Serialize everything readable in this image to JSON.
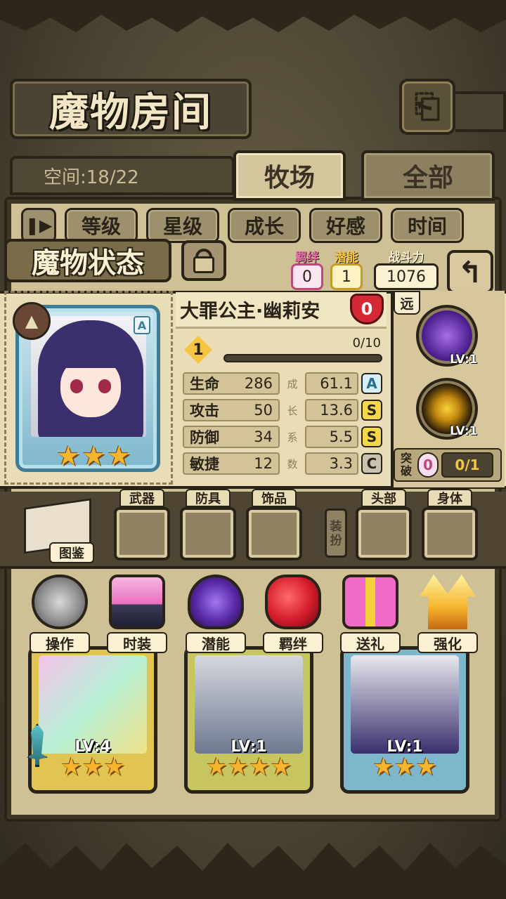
{
  "header": {
    "title": "魔物房间",
    "back_icon": "back-arrow-icon"
  },
  "space": {
    "label": "空间:18/22"
  },
  "tabs": [
    {
      "label": "牧场",
      "active": true
    },
    {
      "label": "全部",
      "active": false
    }
  ],
  "filters": {
    "pause_icon": "pause-icon",
    "items": [
      "等级",
      "星级",
      "成长",
      "好感",
      "时间"
    ]
  },
  "status": {
    "title": "魔物状态",
    "lock_icon": "lock-icon",
    "bond": {
      "label": "羁绊",
      "value": "0",
      "color": "#e86fa8"
    },
    "potential": {
      "label": "潜能",
      "value": "1",
      "color": "#f5c542"
    },
    "power": {
      "label": "战斗力",
      "value": "1076"
    },
    "return_icon": "return-arrow-icon"
  },
  "monster": {
    "name": "大罪公主·幽莉安",
    "affection": "0",
    "rank": "A",
    "type_icon": "mountain-type-icon",
    "stars": 3,
    "level": "1",
    "exp": "0/10",
    "growth_label_chars": [
      "成",
      "长",
      "系",
      "数"
    ],
    "stats": [
      {
        "name": "生命",
        "value": "286",
        "growth": "61.1",
        "grade": "A"
      },
      {
        "name": "攻击",
        "value": "50",
        "growth": "13.6",
        "grade": "S"
      },
      {
        "name": "防御",
        "value": "34",
        "growth": "5.5",
        "grade": "S"
      },
      {
        "name": "敏捷",
        "value": "12",
        "growth": "3.3",
        "grade": "C"
      }
    ],
    "range": "远",
    "skills": [
      {
        "icon": "dark-shadow-skill-icon",
        "level": "LV:1"
      },
      {
        "icon": "golden-slash-skill-icon",
        "level": "LV:1"
      }
    ],
    "breakthrough": {
      "label": "突破",
      "value": "0",
      "count": "0/1"
    }
  },
  "equipment": {
    "book_label": "图鉴",
    "slots": [
      "武器",
      "防具",
      "饰品"
    ],
    "dress_label": "装扮",
    "dress_slots": [
      "头部",
      "身体"
    ]
  },
  "actions": [
    {
      "label": "操作",
      "icon": "gear-icon"
    },
    {
      "label": "时装",
      "icon": "outfit-icon"
    },
    {
      "label": "潜能",
      "icon": "demon-icon"
    },
    {
      "label": "羁绊",
      "icon": "hearts-icon"
    },
    {
      "label": "送礼",
      "icon": "gift-icon"
    },
    {
      "label": "强化",
      "icon": "upgrade-arrows-icon"
    }
  ],
  "monster_list": [
    {
      "level": "LV:4",
      "stars": 3,
      "frame_color": "#e0c552"
    },
    {
      "level": "LV:1",
      "stars": 4,
      "frame_color": "#c7c560"
    },
    {
      "level": "LV:1",
      "stars": 3,
      "frame_color": "#7eb7cc"
    }
  ]
}
